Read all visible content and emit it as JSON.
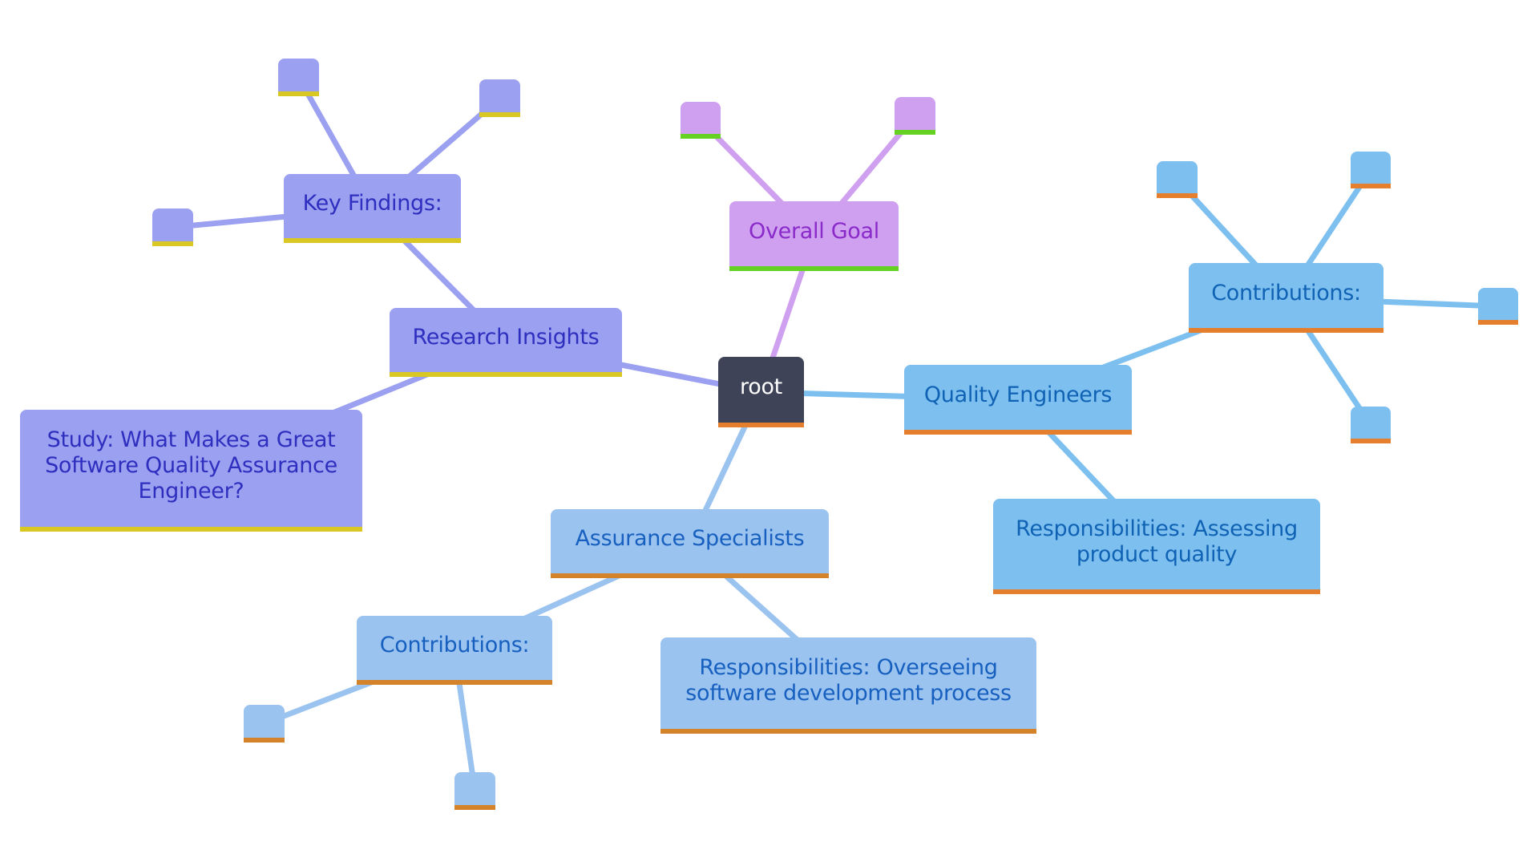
{
  "mindmap": {
    "root": {
      "id": "root",
      "label": "root"
    },
    "branches": [
      {
        "id": "overall-goal",
        "label": "Overall Goal",
        "group": "purple",
        "children": [
          {
            "id": "overall-goal-leaf-1",
            "label": ""
          },
          {
            "id": "overall-goal-leaf-2",
            "label": ""
          }
        ]
      },
      {
        "id": "research-insights",
        "label": "Research Insights",
        "group": "indigo",
        "children": [
          {
            "id": "key-findings",
            "label": "Key Findings:",
            "children": [
              {
                "id": "key-findings-leaf-1",
                "label": ""
              },
              {
                "id": "key-findings-leaf-2",
                "label": ""
              },
              {
                "id": "key-findings-leaf-3",
                "label": ""
              }
            ]
          },
          {
            "id": "study",
            "label": "Study: What Makes a Great Software Quality Assurance Engineer?"
          }
        ]
      },
      {
        "id": "quality-engineers",
        "label": "Quality Engineers",
        "group": "sky",
        "children": [
          {
            "id": "qe-contributions",
            "label": "Contributions:",
            "children": [
              {
                "id": "qe-contributions-leaf-1",
                "label": ""
              },
              {
                "id": "qe-contributions-leaf-2",
                "label": ""
              },
              {
                "id": "qe-contributions-leaf-3",
                "label": ""
              },
              {
                "id": "qe-contributions-leaf-4",
                "label": ""
              }
            ]
          },
          {
            "id": "qe-responsibilities",
            "label": "Responsibilities: Assessing product quality"
          }
        ]
      },
      {
        "id": "assurance-specialists",
        "label": "Assurance Specialists",
        "group": "light-blue",
        "children": [
          {
            "id": "as-contributions",
            "label": "Contributions:",
            "children": [
              {
                "id": "as-contributions-leaf-1",
                "label": ""
              },
              {
                "id": "as-contributions-leaf-2",
                "label": ""
              }
            ]
          },
          {
            "id": "as-responsibilities",
            "label": "Responsibilities: Overseeing software development process"
          }
        ]
      }
    ]
  },
  "theme": {
    "root": {
      "fill": "#3F4358",
      "text": "#FFFFFF",
      "accent": "#E57E2D",
      "edge": "#3F4358"
    },
    "purple": {
      "fill": "#CF9FF0",
      "text": "#8A2BC9",
      "accent": "#64D123",
      "edge": "#CF9FF0"
    },
    "indigo": {
      "fill": "#9BA0F0",
      "text": "#2E2EBF",
      "accent": "#D9C823",
      "edge": "#9BA0F0"
    },
    "sky": {
      "fill": "#7DC0F0",
      "text": "#0F62B4",
      "accent": "#E57E2D",
      "edge": "#7DC0F0"
    },
    "light-blue": {
      "fill": "#9BC3F0",
      "text": "#1760BF",
      "accent": "#D5832A",
      "edge": "#9BC3F0"
    }
  }
}
